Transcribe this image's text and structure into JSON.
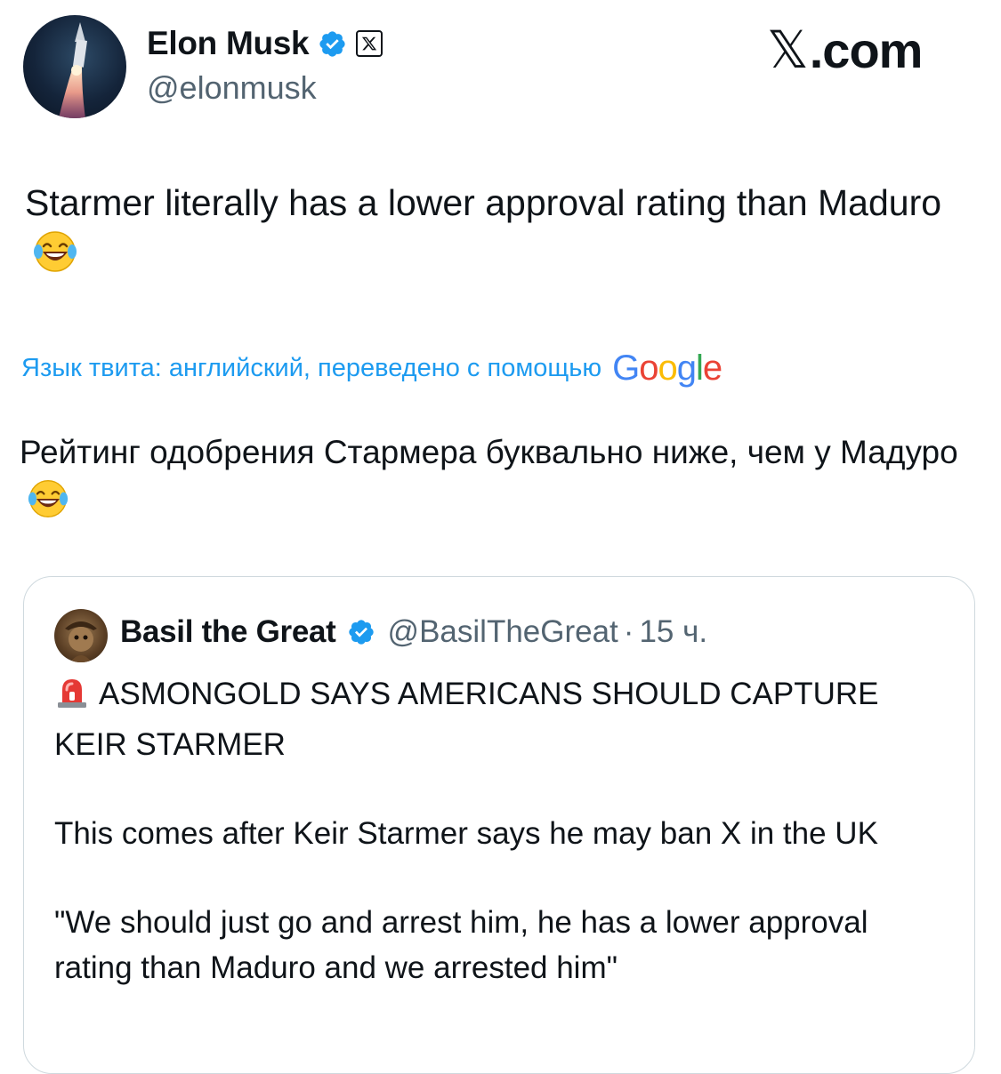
{
  "author": {
    "name": "Elon Musk",
    "handle": "@elonmusk"
  },
  "brand": {
    "x_glyph": "𝕏",
    "suffix": ".com"
  },
  "tweet": {
    "text": "Starmer literally has a lower approval rating than Maduro",
    "emoji": "face-with-tears-of-joy"
  },
  "translation": {
    "notice": "Язык твита: английский, переведено с помощью",
    "provider": "Google",
    "text": "Рейтинг одобрения Стармера буквально ниже, чем у Мадуро"
  },
  "quote": {
    "name": "Basil the Great",
    "handle": "@BasilTheGreat",
    "separator": "·",
    "time": "15 ч.",
    "headline": "ASMONGOLD SAYS AMERICANS SHOULD CAPTURE KEIR STARMER",
    "paragraph2": "This comes after Keir Starmer says he may ban X in the UK",
    "paragraph3": "\"We should just go and arrest him, he has a lower approval rating than Maduro and we arrested him\""
  },
  "colors": {
    "text": "#0f1419",
    "secondary": "#536471",
    "link": "#1d9bf0",
    "verified": "#1d9bf0",
    "border": "#cfd9de"
  }
}
